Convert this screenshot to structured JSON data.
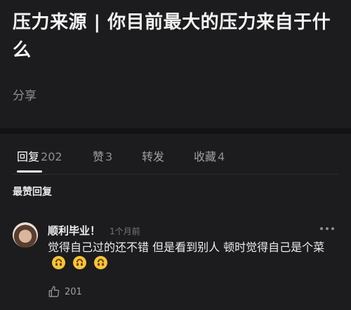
{
  "post": {
    "title": "压力来源 | 你目前最大的压力来自于什么",
    "share_label": "分享"
  },
  "tabs": [
    {
      "label": "回复",
      "count": "202",
      "active": true
    },
    {
      "label": "赞",
      "count": "3",
      "active": false
    },
    {
      "label": "转发",
      "count": "",
      "active": false
    },
    {
      "label": "收藏",
      "count": "4",
      "active": false
    }
  ],
  "section": {
    "title": "最赞回复"
  },
  "comment": {
    "author": "顺利毕业！",
    "time": "1个月前",
    "text": "觉得自己过的还不错 但是看到别人 顿时觉得自己是个菜",
    "emojis": [
      "upside-down-face-emoji",
      "upside-down-face-emoji",
      "upside-down-face-emoji"
    ],
    "likes": "201"
  },
  "colors": {
    "background": "#1c1c1e",
    "separator": "#121212",
    "muted_text": "#8e8e93",
    "emoji_yellow": "#f6c437"
  }
}
